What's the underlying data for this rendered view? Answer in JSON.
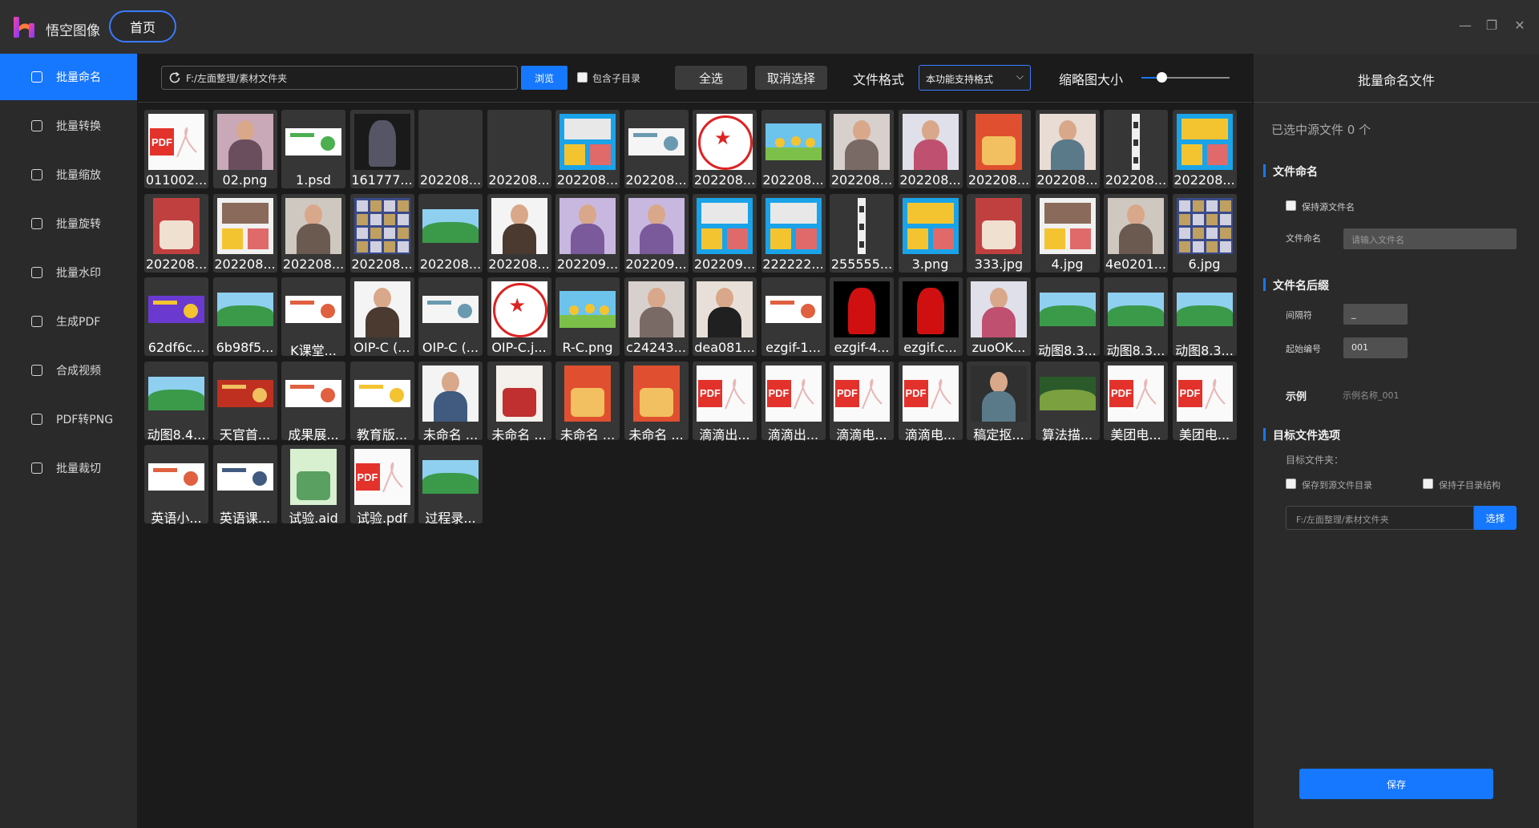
{
  "app": {
    "name": "悟空图像",
    "home_tab": "首页"
  },
  "window_controls": {
    "minimize": "—",
    "restore": "❐",
    "close": "✕"
  },
  "sidebar": {
    "items": [
      {
        "label": "批量命名",
        "icon": "rename-icon",
        "active": true
      },
      {
        "label": "批量转换",
        "icon": "convert-icon"
      },
      {
        "label": "批量缩放",
        "icon": "resize-icon"
      },
      {
        "label": "批量旋转",
        "icon": "rotate-icon"
      },
      {
        "label": "批量水印",
        "icon": "watermark-icon"
      },
      {
        "label": "生成PDF",
        "icon": "pdf-icon"
      },
      {
        "label": "合成视频",
        "icon": "video-icon"
      },
      {
        "label": "PDF转PNG",
        "icon": "pdf-to-png-icon"
      },
      {
        "label": "批量裁切",
        "icon": "crop-icon"
      }
    ]
  },
  "toolbar": {
    "path": "F:/左面整理/素材文件夹",
    "browse_label": "浏览",
    "include_subdir_label": "包含子目录",
    "include_subdir_checked": false,
    "select_all_label": "全选",
    "deselect_label": "取消选择",
    "format_label": "文件格式",
    "format_value": "本功能支持格式",
    "thumb_size_label": "缩略图大小",
    "thumb_size_level": 0.23
  },
  "files": [
    {
      "name": "011002...",
      "kind": "pdf"
    },
    {
      "name": "02.png",
      "kind": "photo",
      "c1": "#c9a9b7",
      "c2": "#6b4e5e"
    },
    {
      "name": "1.psd",
      "kind": "banner",
      "c1": "#ffffff",
      "c2": "#4caf50"
    },
    {
      "name": "161777...",
      "kind": "dark",
      "c1": "#1a1a1a",
      "c2": "#556"
    },
    {
      "name": "202208...",
      "kind": "empty"
    },
    {
      "name": "202208...",
      "kind": "empty"
    },
    {
      "name": "202208...",
      "kind": "collage",
      "c1": "#1aa3e8",
      "c2": "#e8e8e8"
    },
    {
      "name": "202208...",
      "kind": "banner",
      "c1": "#f5f5f5",
      "c2": "#6a9ab0"
    },
    {
      "name": "202208...",
      "kind": "stamp"
    },
    {
      "name": "202208...",
      "kind": "cartoon",
      "c1": "#6cc3ec",
      "c2": "#f4c430"
    },
    {
      "name": "202208...",
      "kind": "photo",
      "c1": "#d8d0cc",
      "c2": "#7a6a66"
    },
    {
      "name": "202208...",
      "kind": "photo",
      "c1": "#e0e0ea",
      "c2": "#c05070"
    },
    {
      "name": "202208...",
      "kind": "poster",
      "c1": "#e05030",
      "c2": "#f2c060"
    },
    {
      "name": "202208...",
      "kind": "photo",
      "c1": "#e8dcd4",
      "c2": "#5a7a8a"
    },
    {
      "name": "202208...",
      "kind": "strip",
      "c1": "#f0f0f0",
      "c2": "#333"
    },
    {
      "name": "202208...",
      "kind": "collage",
      "c1": "#1aa3e8",
      "c2": "#f4c430"
    },
    {
      "name": "202208...",
      "kind": "poster",
      "c1": "#c04040",
      "c2": "#f0e0d0"
    },
    {
      "name": "202208...",
      "kind": "collage",
      "c1": "#f0f0f0",
      "c2": "#8a6a5a"
    },
    {
      "name": "202208...",
      "kind": "photo",
      "c1": "#cfc8c0",
      "c2": "#6a5a50"
    },
    {
      "name": "202208...",
      "kind": "mosaic",
      "c1": "#3a4a8a",
      "c2": "#c0a060"
    },
    {
      "name": "202208...",
      "kind": "landscape",
      "c1": "#8fd0f0",
      "c2": "#3a9a4a"
    },
    {
      "name": "202208...",
      "kind": "photo",
      "c1": "#f4f4f4",
      "c2": "#4a3a30"
    },
    {
      "name": "202209...",
      "kind": "photo",
      "c1": "#c8b8e0",
      "c2": "#7a5a9a"
    },
    {
      "name": "202209...",
      "kind": "photo",
      "c1": "#c8b8e0",
      "c2": "#7a5a9a"
    },
    {
      "name": "202209...",
      "kind": "collage",
      "c1": "#1aa3e8",
      "c2": "#e8e8e8"
    },
    {
      "name": "222222...",
      "kind": "collage",
      "c1": "#1aa3e8",
      "c2": "#e8e8e8"
    },
    {
      "name": "255555...",
      "kind": "strip",
      "c1": "#f0f0f0",
      "c2": "#333"
    },
    {
      "name": "3.png",
      "kind": "collage",
      "c1": "#1aa3e8",
      "c2": "#f4c430"
    },
    {
      "name": "333.jpg",
      "kind": "poster",
      "c1": "#c04040",
      "c2": "#f0e0d0"
    },
    {
      "name": "4.jpg",
      "kind": "collage",
      "c1": "#f0f0f0",
      "c2": "#8a6a5a"
    },
    {
      "name": "4e0201...",
      "kind": "photo",
      "c1": "#cfc8c0",
      "c2": "#6a5a50"
    },
    {
      "name": "6.jpg",
      "kind": "mosaic",
      "c1": "#3a4a8a",
      "c2": "#c0a060"
    },
    {
      "name": "62df6c...",
      "kind": "banner",
      "c1": "#6a3ad0",
      "c2": "#f4c430"
    },
    {
      "name": "6b98f5...",
      "kind": "landscape",
      "c1": "#8fd0f0",
      "c2": "#3a9a4a"
    },
    {
      "name": "K课堂...",
      "kind": "banner",
      "c1": "#ffffff",
      "c2": "#e06040"
    },
    {
      "name": "OIP-C (...",
      "kind": "photo",
      "c1": "#f4f4f4",
      "c2": "#4a3a30"
    },
    {
      "name": "OIP-C (...",
      "kind": "banner",
      "c1": "#f5f5f5",
      "c2": "#6a9ab0"
    },
    {
      "name": "OIP-C.j...",
      "kind": "stamp"
    },
    {
      "name": "R-C.png",
      "kind": "cartoon",
      "c1": "#6cc3ec",
      "c2": "#f4c430"
    },
    {
      "name": "c24243...",
      "kind": "photo",
      "c1": "#d8d0cc",
      "c2": "#7a6a66"
    },
    {
      "name": "dea081...",
      "kind": "photo",
      "c1": "#e8e0d8",
      "c2": "#202020"
    },
    {
      "name": "ezgif-1...",
      "kind": "banner",
      "c1": "#ffffff",
      "c2": "#e06040"
    },
    {
      "name": "ezgif-4...",
      "kind": "dark",
      "c1": "#000000",
      "c2": "#d01010"
    },
    {
      "name": "ezgif.c...",
      "kind": "dark",
      "c1": "#000000",
      "c2": "#d01010"
    },
    {
      "name": "zuoOK...",
      "kind": "photo",
      "c1": "#e0e0ea",
      "c2": "#c05070"
    },
    {
      "name": "动图8.3...",
      "kind": "landscape",
      "c1": "#8fd0f0",
      "c2": "#3a9a4a"
    },
    {
      "name": "动图8.3...",
      "kind": "landscape",
      "c1": "#8fd0f0",
      "c2": "#3a9a4a"
    },
    {
      "name": "动图8.3...",
      "kind": "landscape",
      "c1": "#8fd0f0",
      "c2": "#3a9a4a"
    },
    {
      "name": "动图8.4...",
      "kind": "landscape",
      "c1": "#8fd0f0",
      "c2": "#3a9a4a"
    },
    {
      "name": "天官首...",
      "kind": "banner",
      "c1": "#c03020",
      "c2": "#f0c060"
    },
    {
      "name": "成果展...",
      "kind": "banner",
      "c1": "#ffffff",
      "c2": "#e06040"
    },
    {
      "name": "教育版...",
      "kind": "banner",
      "c1": "#ffffff",
      "c2": "#f4c430"
    },
    {
      "name": "未命名 ...",
      "kind": "photo",
      "c1": "#f4f4f4",
      "c2": "#405a80"
    },
    {
      "name": "未命名 ...",
      "kind": "poster",
      "c1": "#f4f0ec",
      "c2": "#c03030"
    },
    {
      "name": "未命名 ...",
      "kind": "poster",
      "c1": "#e05030",
      "c2": "#f2c060"
    },
    {
      "name": "未命名 ...",
      "kind": "poster",
      "c1": "#e05030",
      "c2": "#f2c060"
    },
    {
      "name": "滴滴出...",
      "kind": "pdf"
    },
    {
      "name": "滴滴出...",
      "kind": "pdf"
    },
    {
      "name": "滴滴电...",
      "kind": "pdf"
    },
    {
      "name": "滴滴电...",
      "kind": "pdf"
    },
    {
      "name": "稿定抠...",
      "kind": "photo",
      "c1": "#303030",
      "c2": "#5a7a8a"
    },
    {
      "name": "算法描...",
      "kind": "landscape",
      "c1": "#2a5a2a",
      "c2": "#7aa040"
    },
    {
      "name": "美团电...",
      "kind": "pdf"
    },
    {
      "name": "美团电...",
      "kind": "pdf"
    },
    {
      "name": "英语小...",
      "kind": "banner",
      "c1": "#ffffff",
      "c2": "#e06040"
    },
    {
      "name": "英语课...",
      "kind": "banner",
      "c1": "#ffffff",
      "c2": "#405a80"
    },
    {
      "name": "试验.aid",
      "kind": "poster",
      "c1": "#d8f0d0",
      "c2": "#5aa060"
    },
    {
      "name": "试验.pdf",
      "kind": "pdf"
    },
    {
      "name": "过程录...",
      "kind": "landscape",
      "c1": "#8fd0f0",
      "c2": "#3a9a4a"
    }
  ],
  "right_panel": {
    "title": "批量命名文件",
    "selected_count": "已选中源文件 0 个",
    "file_naming": {
      "title": "文件命名",
      "keep_source_label": "保持源文件名",
      "name_label": "文件命名",
      "name_placeholder": "请输入文件名"
    },
    "suffix": {
      "title": "文件名后缀",
      "separator_label": "间隔符",
      "separator_value": "_",
      "start_label": "起始编号",
      "start_value": "001"
    },
    "example": {
      "label": "示例",
      "value": "示例名称_001"
    },
    "target": {
      "title": "目标文件选项",
      "folder_label": "目标文件夹：",
      "save_to_source_label": "保存到源文件目录",
      "keep_structure_label": "保持子目录结构",
      "path": "F:/左面整理/素材文件夹",
      "choose_label": "选择"
    },
    "save_label": "保存"
  },
  "colors": {
    "accent": "#1677ff",
    "pdf_red": "#e3322b"
  }
}
